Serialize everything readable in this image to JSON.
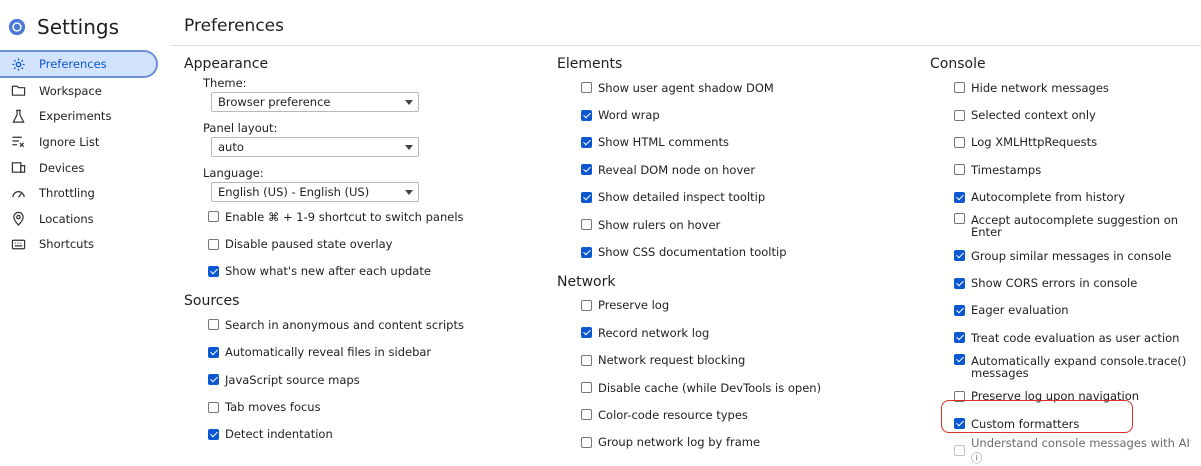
{
  "app": {
    "title": "Settings"
  },
  "sidebar": {
    "items": [
      {
        "label": "Preferences",
        "icon": "gear-icon",
        "active": true
      },
      {
        "label": "Workspace",
        "icon": "folder-icon"
      },
      {
        "label": "Experiments",
        "icon": "flask-icon"
      },
      {
        "label": "Ignore List",
        "icon": "ignore-list-icon"
      },
      {
        "label": "Devices",
        "icon": "devices-icon"
      },
      {
        "label": "Throttling",
        "icon": "gauge-icon"
      },
      {
        "label": "Locations",
        "icon": "location-pin-icon"
      },
      {
        "label": "Shortcuts",
        "icon": "keyboard-icon"
      }
    ]
  },
  "page": {
    "title": "Preferences"
  },
  "appearance": {
    "title": "Appearance",
    "theme": {
      "label": "Theme:",
      "value": "Browser preference"
    },
    "panel_layout": {
      "label": "Panel layout:",
      "value": "auto"
    },
    "language": {
      "label": "Language:",
      "value": "English (US) - English (US)"
    },
    "options": [
      {
        "label": "Enable ⌘ + 1-9 shortcut to switch panels",
        "checked": false
      },
      {
        "label": "Disable paused state overlay",
        "checked": false
      },
      {
        "label": "Show what's new after each update",
        "checked": true
      }
    ]
  },
  "sources": {
    "title": "Sources",
    "options": [
      {
        "label": "Search in anonymous and content scripts",
        "checked": false
      },
      {
        "label": "Automatically reveal files in sidebar",
        "checked": true
      },
      {
        "label": "JavaScript source maps",
        "checked": true
      },
      {
        "label": "Tab moves focus",
        "checked": false
      },
      {
        "label": "Detect indentation",
        "checked": true
      }
    ]
  },
  "elements": {
    "title": "Elements",
    "options": [
      {
        "label": "Show user agent shadow DOM",
        "checked": false
      },
      {
        "label": "Word wrap",
        "checked": true
      },
      {
        "label": "Show HTML comments",
        "checked": true
      },
      {
        "label": "Reveal DOM node on hover",
        "checked": true
      },
      {
        "label": "Show detailed inspect tooltip",
        "checked": true
      },
      {
        "label": "Show rulers on hover",
        "checked": false
      },
      {
        "label": "Show CSS documentation tooltip",
        "checked": true
      }
    ]
  },
  "network": {
    "title": "Network",
    "options": [
      {
        "label": "Preserve log",
        "checked": false
      },
      {
        "label": "Record network log",
        "checked": true
      },
      {
        "label": "Network request blocking",
        "checked": false
      },
      {
        "label": "Disable cache (while DevTools is open)",
        "checked": false
      },
      {
        "label": "Color-code resource types",
        "checked": false
      },
      {
        "label": "Group network log by frame",
        "checked": false
      }
    ]
  },
  "console": {
    "title": "Console",
    "options": [
      {
        "label": "Hide network messages",
        "checked": false
      },
      {
        "label": "Selected context only",
        "checked": false
      },
      {
        "label": "Log XMLHttpRequests",
        "checked": false
      },
      {
        "label": "Timestamps",
        "checked": false
      },
      {
        "label": "Autocomplete from history",
        "checked": true
      },
      {
        "label": "Accept autocomplete suggestion on Enter",
        "checked": false
      },
      {
        "label": "Group similar messages in console",
        "checked": true
      },
      {
        "label": "Show CORS errors in console",
        "checked": true
      },
      {
        "label": "Eager evaluation",
        "checked": true
      },
      {
        "label": "Treat code evaluation as user action",
        "checked": true
      },
      {
        "label": "Automatically expand console.trace() messages",
        "checked": true
      },
      {
        "label": "Preserve log upon navigation",
        "checked": false
      },
      {
        "label": "Custom formatters",
        "checked": true,
        "highlighted": true
      },
      {
        "label": "Understand console messages with AI ⓘ",
        "checked": false,
        "disabled": true
      }
    ]
  },
  "colors": {
    "accent": "#0b57d0",
    "active_bg": "#d3e3fd",
    "highlight": "#d93025"
  }
}
